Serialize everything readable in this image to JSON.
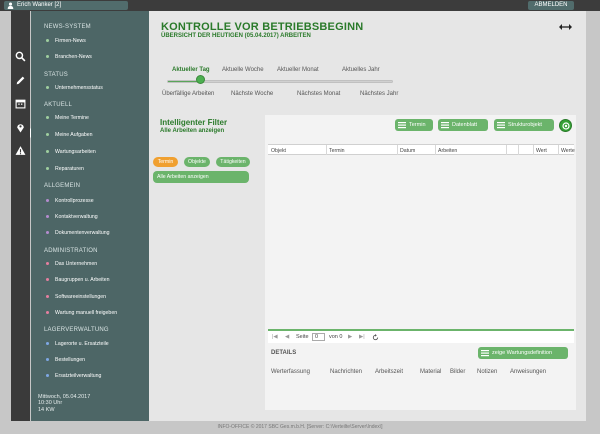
{
  "header": {
    "user": "Erich Wanker [2]",
    "logout": "ABMELDEN"
  },
  "rail": [
    "search-icon",
    "pencil-icon",
    "calendar-icon",
    "location-icon",
    "warning-icon"
  ],
  "nav": {
    "sections": [
      {
        "heading": "NEWS-SYSTEM",
        "items": [
          {
            "label": "Firmen-News",
            "dot": "#9fcf9f"
          },
          {
            "label": "Branchen-News",
            "dot": "#9fcf9f"
          }
        ]
      },
      {
        "heading": "STATUS",
        "items": [
          {
            "label": "Unternehmensstatus",
            "dot": "#9fcf9f"
          }
        ]
      },
      {
        "heading": "AKTUELL",
        "items": [
          {
            "label": "Meine Termine",
            "dot": "#9fcf9f"
          },
          {
            "label": "Meine Aufgaben",
            "dot": "#9fcf9f"
          },
          {
            "label": "Wartungsarbeiten",
            "dot": "#9fcf9f"
          },
          {
            "label": "Reparaturen",
            "dot": "#9fcf9f"
          }
        ]
      },
      {
        "heading": "ALLGEMEIN",
        "items": [
          {
            "label": "Kontrollprozesse",
            "dot": "#b58ccf"
          },
          {
            "label": "Kontaktverwaltung",
            "dot": "#b58ccf"
          },
          {
            "label": "Dokumentenverwaltung",
            "dot": "#b58ccf"
          }
        ]
      },
      {
        "heading": "ADMINISTRATION",
        "items": [
          {
            "label": "Das Unternehmen",
            "dot": "#e57fa0"
          },
          {
            "label": "Baugruppen u. Arbeiten",
            "dot": "#e57fa0"
          },
          {
            "label": "Softwareeinstellungen",
            "dot": "#e57fa0"
          },
          {
            "label": "Wartung manuell freigeben",
            "dot": "#e57fa0"
          }
        ]
      },
      {
        "heading": "LAGERVERWALTUNG",
        "items": [
          {
            "label": "Lagerorte u. Ersatzteile",
            "dot": "#7fa8e5"
          },
          {
            "label": "Bestellungen",
            "dot": "#7fa8e5"
          },
          {
            "label": "Ersatzteilverwaltung",
            "dot": "#7fa8e5"
          }
        ]
      }
    ],
    "footer": {
      "date": "Mittwoch, 05.04.2017",
      "time": "10:30 Uhr",
      "week": "14 KW"
    }
  },
  "main": {
    "title": "KONTROLLE VOR BETRIEBSBEGINN",
    "subtitle": "ÜBERSICHT DER HEUTIGEN (05.04.2017) ARBEITEN",
    "timeline": {
      "top": [
        "Aktueller Tag",
        "Aktuelle Woche",
        "Aktueller Monat",
        "Aktuelles Jahr"
      ],
      "bottom": [
        "Überfällige Arbeiten",
        "Nächste Woche",
        "Nächstes Monat",
        "Nächstes Jahr"
      ],
      "selected": "Aktueller Tag"
    },
    "filter": {
      "title": "Intelligenter Filter",
      "subtitle": "Alle Arbeiten anzeigen",
      "chips": [
        {
          "label": "Termin",
          "color": "#f0a030"
        },
        {
          "label": "Objekte",
          "color": "#6bb46b"
        },
        {
          "label": "Tätigkeiten",
          "color": "#6bb46b"
        }
      ],
      "all": "Alle Arbeiten anzeigen"
    },
    "toolbar": {
      "termin": "Termin",
      "datenblatt": "Datenblatt",
      "strukturobjekt": "Strukturobjekt"
    },
    "table": {
      "columns": [
        "Objekt",
        "Termin",
        "Datum",
        "Arbeiten",
        "Wert",
        "Werte"
      ]
    },
    "pager": {
      "page_label": "Seite",
      "page": "0",
      "of": "von 0"
    },
    "details": {
      "title": "DETAILS",
      "button": "zeige Wartungsdefinition",
      "tabs": [
        "Werterfassung",
        "Nachrichten",
        "Arbeitszeit",
        "Material",
        "Bilder",
        "Notizen",
        "Anweisungen"
      ]
    }
  },
  "footer": "INFO-OFFICE © 2017 SBC Ges.m.b.H. [Server: C:\\Verteilte\\Server\\Index\\]"
}
